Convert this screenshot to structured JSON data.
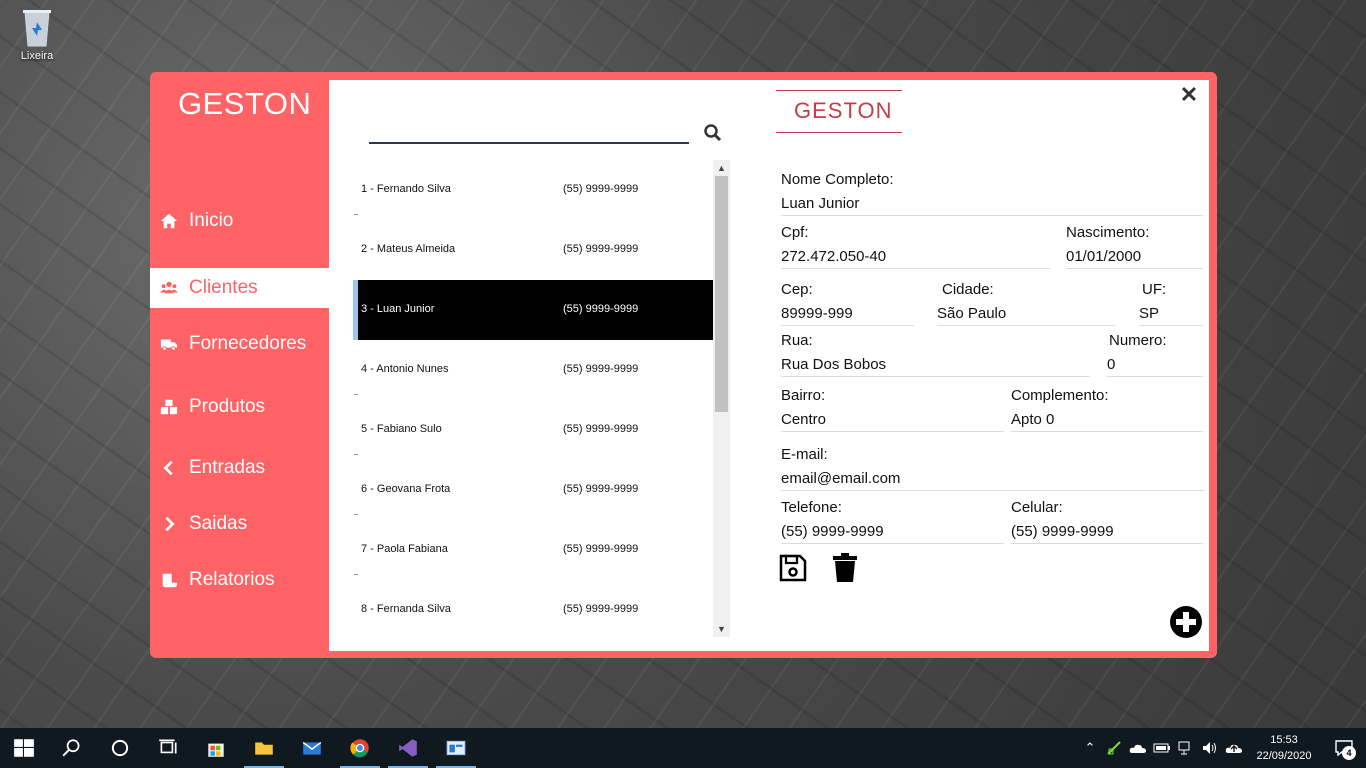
{
  "desktop": {
    "recycle_bin_label": "Lixeira"
  },
  "app": {
    "brand": "GESTON",
    "logo_text": "GESTON",
    "accent_color": "#ff6366",
    "nav": [
      {
        "label": "Inicio",
        "icon": "home-icon"
      },
      {
        "label": "Clientes",
        "icon": "users-icon",
        "active": true
      },
      {
        "label": "Fornecedores",
        "icon": "truck-icon"
      },
      {
        "label": "Produtos",
        "icon": "boxes-icon"
      },
      {
        "label": "Entradas",
        "icon": "chevron-left-icon"
      },
      {
        "label": "Saidas",
        "icon": "chevron-right-icon"
      },
      {
        "label": "Relatorios",
        "icon": "receipt-icon"
      }
    ],
    "close_symbol": "✕"
  },
  "search": {
    "value": "",
    "placeholder": ""
  },
  "clients": [
    {
      "name": "1 - Fernando Silva",
      "phone": "(55) 9999-9999"
    },
    {
      "name": "2 - Mateus Almeida",
      "phone": "(55) 9999-9999"
    },
    {
      "name": "3 - Luan Junior",
      "phone": "(55) 9999-9999",
      "selected": true
    },
    {
      "name": "4 - Antonio Nunes",
      "phone": "(55) 9999-9999"
    },
    {
      "name": "5 - Fabiano Sulo",
      "phone": "(55) 9999-9999"
    },
    {
      "name": "6 - Geovana Frota",
      "phone": "(55) 9999-9999"
    },
    {
      "name": "7 - Paola Fabiana",
      "phone": "(55) 9999-9999"
    },
    {
      "name": "8 - Fernanda Silva",
      "phone": "(55) 9999-9999"
    }
  ],
  "form": {
    "nome": {
      "label": "Nome Completo:",
      "value": "Luan Junior"
    },
    "cpf": {
      "label": "Cpf:",
      "value": "272.472.050-40"
    },
    "nascimento": {
      "label": "Nascimento:",
      "value": "01/01/2000"
    },
    "cep": {
      "label": "Cep:",
      "value": "89999-999"
    },
    "cidade": {
      "label": "Cidade:",
      "value": "São Paulo"
    },
    "uf": {
      "label": "UF:",
      "value": "SP"
    },
    "rua": {
      "label": "Rua:",
      "value": "Rua Dos Bobos"
    },
    "numero": {
      "label": "Numero:",
      "value": "0"
    },
    "bairro": {
      "label": "Bairro:",
      "value": "Centro"
    },
    "complemento": {
      "label": "Complemento:",
      "value": "Apto 0"
    },
    "email": {
      "label": "E-mail:",
      "value": "email@email.com"
    },
    "telefone": {
      "label": "Telefone:",
      "value": "(55) 9999-9999"
    },
    "celular": {
      "label": "Celular:",
      "value": "(55) 9999-9999"
    }
  },
  "taskbar": {
    "time": "15:53",
    "date": "22/09/2020",
    "notifications": "4"
  }
}
